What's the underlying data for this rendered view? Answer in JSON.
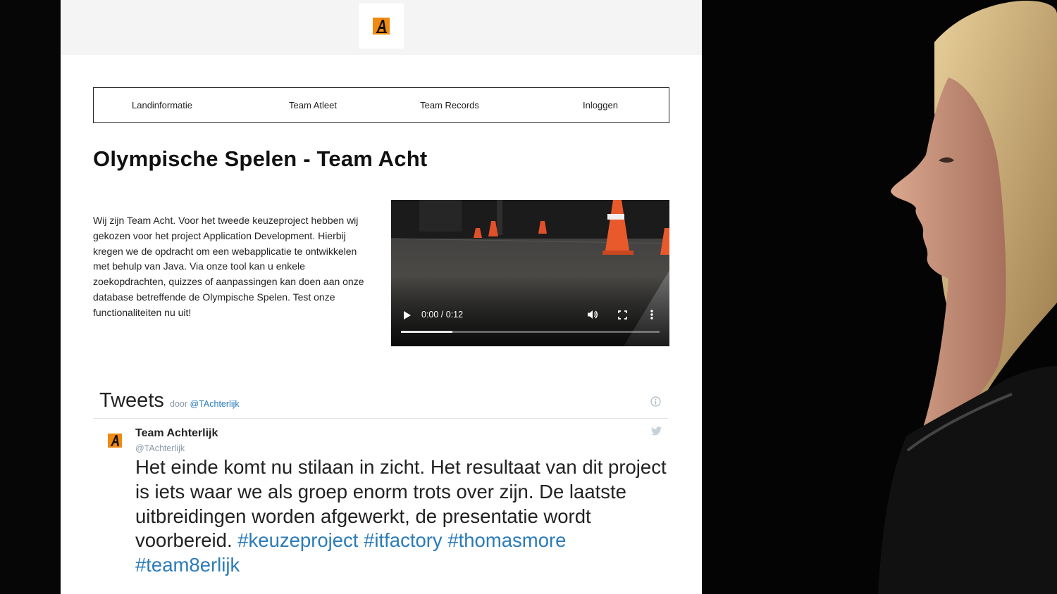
{
  "brand": {
    "logo_text": "A",
    "logo_color": "#f08a10"
  },
  "nav": {
    "items": [
      {
        "label": "Landinformatie"
      },
      {
        "label": "Team Atleet"
      },
      {
        "label": "Team Records"
      },
      {
        "label": "Inloggen"
      }
    ]
  },
  "main": {
    "title": "Olympische Spelen - Team Acht",
    "intro": "Wij zijn Team Acht. Voor het tweede keuzeproject hebben wij gekozen voor het project Application Development. Hierbij kregen we de opdracht om een webapplicatie te ontwikkelen met behulp van Java. Via onze tool kan u enkele zoekopdrachten, quizzes of aanpassingen kan doen aan onze database betreffende de Olympische Spelen. Test onze functionaliteiten nu uit!"
  },
  "video": {
    "time_display": "0:00 / 0:12",
    "buffered_fraction": 0.2
  },
  "tweets": {
    "header_title": "Tweets",
    "by_label": "door",
    "by_handle": "@TAchterlijk",
    "items": [
      {
        "name": "Team Achterlijk",
        "handle": "@TAchterlijk",
        "text": "Het einde komt nu stilaan in zicht. Het resultaat van dit project is iets waar we als groep enorm trots over zijn. De laatste uitbreidingen worden afgewerkt, de presentatie wordt voorbereid.",
        "hashtags": [
          "#keuzeproject",
          "#itfactory",
          "#thomasmore",
          "#team8erlijk"
        ]
      }
    ]
  },
  "colors": {
    "link": "#2b7bb9",
    "muted": "#8899a6",
    "accent": "#f08a10"
  },
  "icons": [
    "play-icon",
    "volume-icon",
    "fullscreen-icon",
    "more-icon",
    "info-icon",
    "twitter-bird-icon"
  ]
}
